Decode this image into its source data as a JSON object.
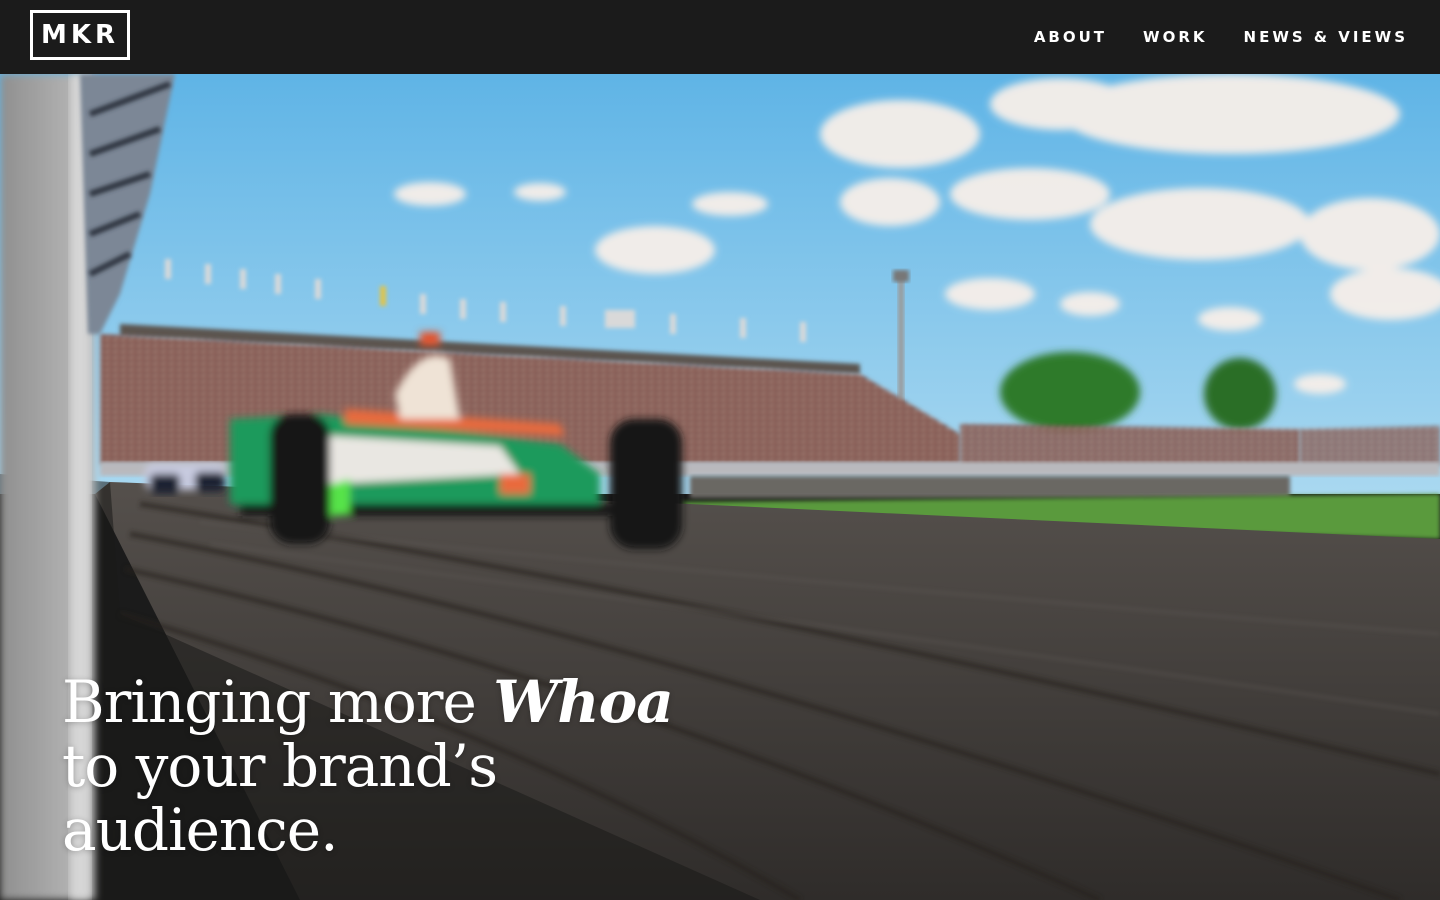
{
  "header": {
    "logo_text": "MKR",
    "nav": [
      {
        "label": "ABOUT"
      },
      {
        "label": "WORK"
      },
      {
        "label": "NEWS & VIEWS"
      }
    ]
  },
  "hero": {
    "headline_line1_prefix": "Bringing more",
    "headline_emphasis": "Whoa",
    "headline_line2": "to your brand’s",
    "headline_line3": "audience."
  },
  "colors": {
    "header_bg": "#1b1b1b",
    "text": "#ffffff",
    "sky": "#7cc3ea",
    "track": "#3f3c3a",
    "car_green": "#1f9a5c",
    "grass": "#5a9a3e"
  }
}
